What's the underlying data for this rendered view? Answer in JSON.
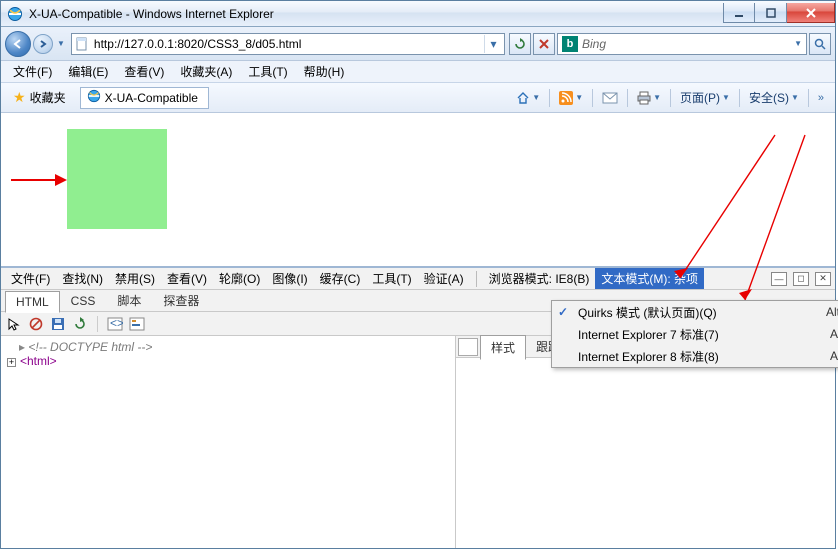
{
  "titlebar": {
    "title": "X-UA-Compatible - Windows Internet Explorer"
  },
  "nav": {
    "url": "http://127.0.0.1:8020/CSS3_8/d05.html",
    "search_placeholder": "Bing"
  },
  "menubar": {
    "items": [
      "文件(F)",
      "编辑(E)",
      "查看(V)",
      "收藏夹(A)",
      "工具(T)",
      "帮助(H)"
    ]
  },
  "favbar": {
    "fav_label": "收藏夹",
    "tab_title": "X-UA-Compatible",
    "page_menu": "页面(P)",
    "safety_menu": "安全(S)"
  },
  "devtools": {
    "menu": [
      "文件(F)",
      "查找(N)",
      "禁用(S)",
      "查看(V)",
      "轮廓(O)",
      "图像(I)",
      "缓存(C)",
      "工具(T)",
      "验证(A)"
    ],
    "browser_mode_label": "浏览器模式: IE8(B)",
    "doc_mode_label": "文本模式(M): 杂项",
    "tabs": [
      "HTML",
      "CSS",
      "脚本",
      "探查器"
    ],
    "active_tab": "HTML",
    "code_comment": "<!-- DOCTYPE html -->",
    "code_tag_open": "<html>",
    "right_tabs": [
      "样式",
      "跟踪样式"
    ],
    "right_active": "样式"
  },
  "dropdown": {
    "items": [
      {
        "label": "Quirks 模式 (默认页面)(Q)",
        "shortcut": "Alt-",
        "checked": true
      },
      {
        "label": "Internet Explorer 7 标准(7)",
        "shortcut": "Alt",
        "checked": false
      },
      {
        "label": "Internet Explorer 8 标准(8)",
        "shortcut": "Alt",
        "checked": false
      }
    ]
  }
}
